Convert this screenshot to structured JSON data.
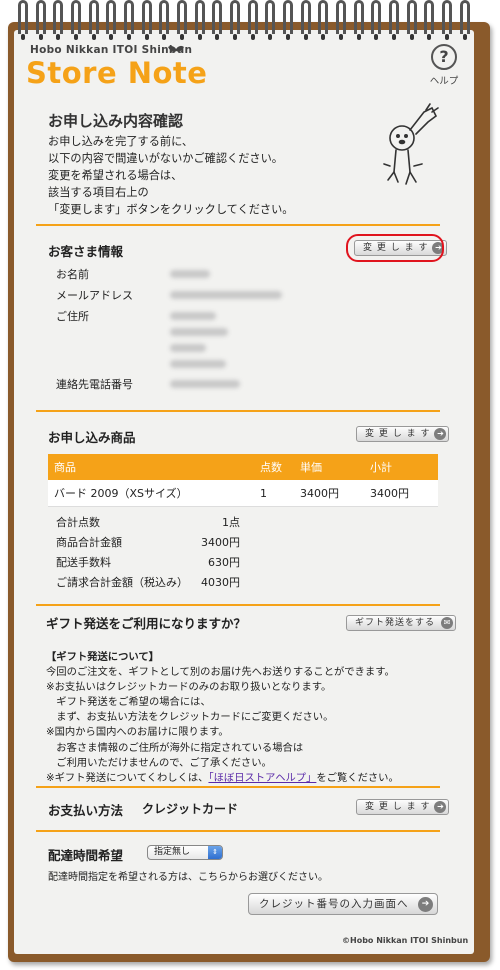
{
  "brand": {
    "subtitle": "Hobo Nikkan ITOI Shinbun",
    "title": "Store Note"
  },
  "help": {
    "label": "ヘルプ",
    "icon": "question-icon"
  },
  "intro": {
    "title": "お申し込み内容確認",
    "text": "お申し込みを完了する前に、\n以下の内容で間違いがないかご確認ください。\n変更を希望される場合は、\n該当する項目右上の\n「変更します」ボタンをクリックしてください。"
  },
  "customer": {
    "title": "お客さま情報",
    "change_label": "変 更 し ま す",
    "fields": {
      "name": "お名前",
      "email": "メールアドレス",
      "address": "ご住所",
      "phone": "連絡先電話番号"
    }
  },
  "order": {
    "title": "お申し込み商品",
    "change_label": "変 更 し ま す",
    "columns": [
      "商品",
      "点数",
      "単価",
      "小計"
    ],
    "rows": [
      {
        "item": "バード 2009（XSサイズ）",
        "qty": "1",
        "price": "3400円",
        "subtotal": "3400円"
      }
    ],
    "totals": [
      {
        "label": "合計点数",
        "value": "1点"
      },
      {
        "label": "商品合計金額",
        "value": "3400円"
      },
      {
        "label": "配送手数料",
        "value": "630円"
      },
      {
        "label": "ご請求合計金額（税込み）",
        "value": "4030円"
      }
    ]
  },
  "gift": {
    "title": "ギフト発送をご利用になりますか？",
    "button_label": "ギフト発送をする",
    "heading": "【ギフト発送について】",
    "line1": "今回のご注文を、ギフトとして別のお届け先へお送りすることができます。",
    "line2": "※お支払いはクレジットカードのみのお取り扱いとなります。",
    "line3": "　ギフト発送をご希望の場合には、",
    "line4": "　まず、お支払い方法をクレジットカードにご変更ください。",
    "line5": "※国内から国内へのお届けに限ります。",
    "line6": "　お客さま情報のご住所が海外に指定されている場合は",
    "line7": "　ご利用いただけませんので、ご了承ください。",
    "line8_pre": "※ギフト発送についてくわしくは、",
    "line8_link": "「ほぼ日ストアヘルプ」",
    "line8_post": "をご覧ください。"
  },
  "payment": {
    "title": "お支払い方法",
    "value": "クレジットカード",
    "change_label": "変 更 し ま す"
  },
  "delivery": {
    "title": "配達時間希望",
    "selected": "指定無し",
    "note": "配達時間指定を希望される方は、こちらからお選びください。"
  },
  "next_button": {
    "label": "クレジット番号の入力画面へ"
  },
  "copyright": "©Hobo Nikkan ITOI Shinbun",
  "colors": {
    "accent": "#f5a218",
    "highlight": "#e0141e",
    "link": "#5a2aa8"
  }
}
